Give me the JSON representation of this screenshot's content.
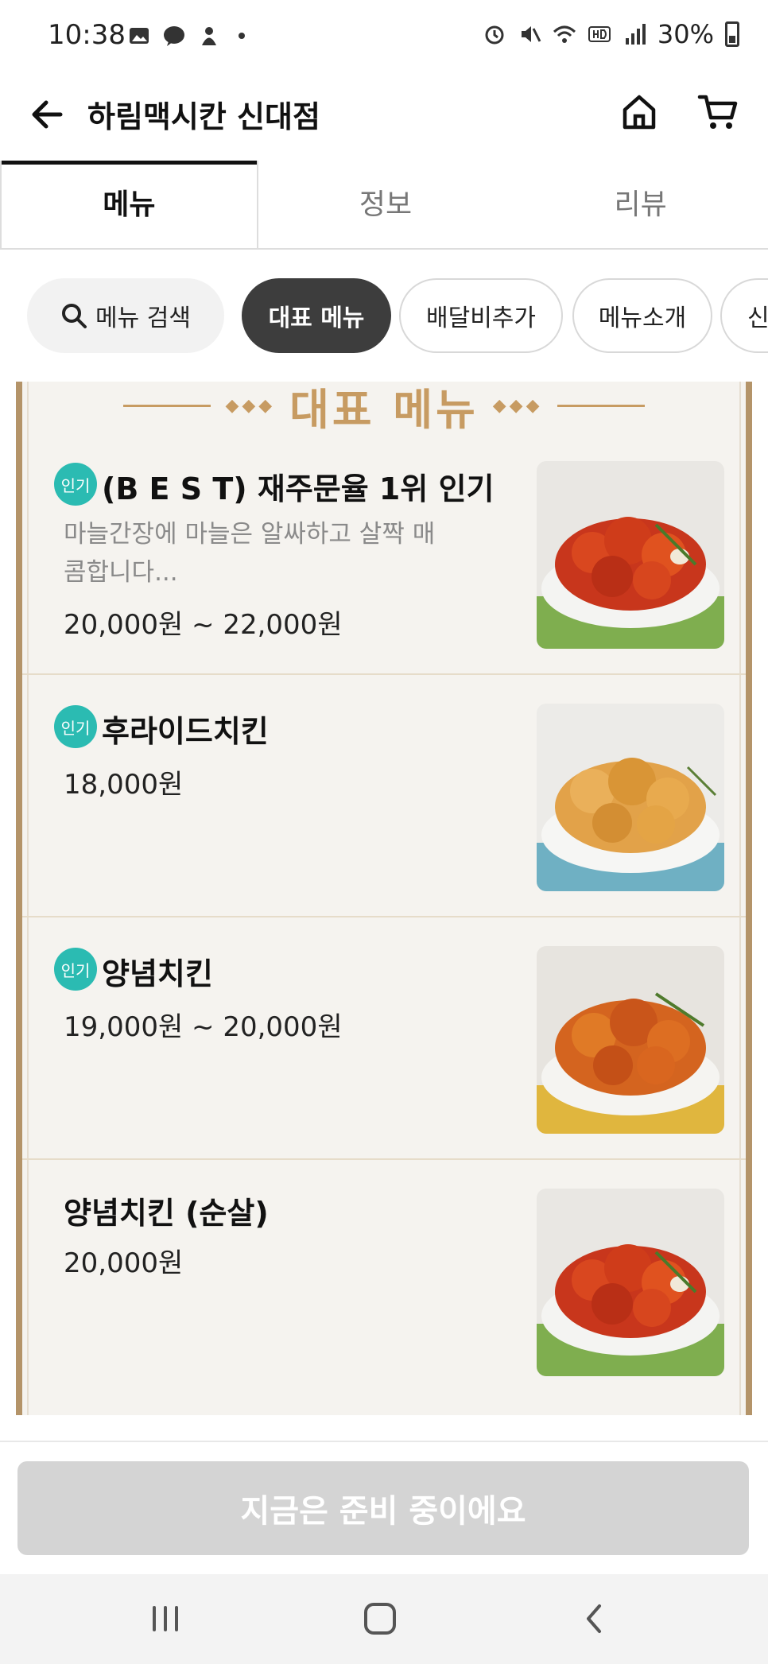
{
  "status_bar": {
    "time": "10:38",
    "battery": "30%"
  },
  "header": {
    "title": "하림맥시칸 신대점"
  },
  "tabs": [
    {
      "label": "메뉴"
    },
    {
      "label": "정보"
    },
    {
      "label": "리뷰"
    }
  ],
  "chips": {
    "search_label": "메뉴 검색",
    "items": [
      {
        "label": "대표 메뉴"
      },
      {
        "label": "배달비추가"
      },
      {
        "label": "메뉴소개"
      },
      {
        "label": "신"
      }
    ]
  },
  "board": {
    "title": "대표 메뉴"
  },
  "menu_items": [
    {
      "badge": "인기",
      "name": "(B E S T) 재주문율 1위 인기...",
      "description": "마늘간장에 마늘은 알싸하고 살짝 매콤합니다...",
      "price": "20,000원 ~ 22,000원"
    },
    {
      "badge": "인기",
      "name": "후라이드치킨",
      "description": "",
      "price": "18,000원"
    },
    {
      "badge": "인기",
      "name": "양념치킨",
      "description": "",
      "price": "19,000원 ~ 20,000원"
    },
    {
      "badge": "",
      "name": "양념치킨 (순살)",
      "description": "",
      "price": "20,000원"
    }
  ],
  "cta": {
    "label": "지금은 준비 중이에요"
  },
  "colors": {
    "badge": "#2bbbb2",
    "gold": "#c79b62",
    "active_chip": "#3d3d3d",
    "cta_disabled": "#d4d4d4"
  }
}
